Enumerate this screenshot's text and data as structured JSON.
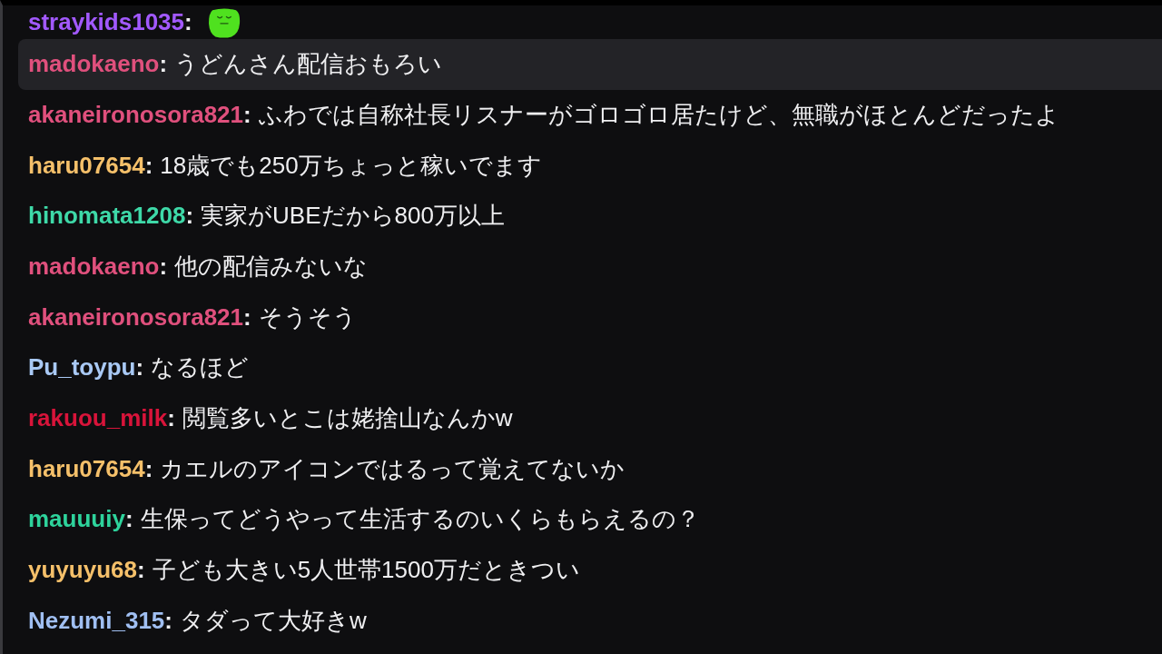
{
  "chat": {
    "messages": [
      {
        "kind": "emote",
        "username": "straykids1035",
        "color": "#a259ff",
        "separator": ":",
        "highlighted": false
      },
      {
        "kind": "text",
        "username": "madokaeno",
        "color": "#e0507d",
        "separator": ":",
        "text": "うどんさん配信おもろい",
        "highlighted": true
      },
      {
        "kind": "text",
        "username": "akaneironosora821",
        "color": "#e0507d",
        "separator": ":",
        "text": "ふわでは自称社長リスナーがゴロゴロ居たけど、無職がほとんどだったよ",
        "highlighted": false
      },
      {
        "kind": "text",
        "username": "haru07654",
        "color": "#f5c06a",
        "separator": ":",
        "text": "18歳でも250万ちょっと稼いでます",
        "highlighted": false
      },
      {
        "kind": "text",
        "username": "hinomata1208",
        "color": "#3ed9a8",
        "separator": ":",
        "text": "実家がUBEだから800万以上",
        "highlighted": false
      },
      {
        "kind": "text",
        "username": "madokaeno",
        "color": "#e0507d",
        "separator": ":",
        "text": "他の配信みないな",
        "highlighted": false
      },
      {
        "kind": "text",
        "username": "akaneironosora821",
        "color": "#e0507d",
        "separator": ":",
        "text": "そうそう",
        "highlighted": false
      },
      {
        "kind": "text",
        "username": "Pu_toypu",
        "color": "#a9c9f5",
        "separator": ":",
        "text": "なるほど",
        "highlighted": false
      },
      {
        "kind": "text",
        "username": "rakuou_milk",
        "color": "#d8143a",
        "separator": ":",
        "text": "閲覧多いとこは姥捨山なんかw",
        "highlighted": false
      },
      {
        "kind": "text",
        "username": "haru07654",
        "color": "#f5c06a",
        "separator": ":",
        "text": "カエルのアイコンではるって覚えてないか",
        "highlighted": false
      },
      {
        "kind": "text",
        "username": "mauuuiy",
        "color": "#2ed39c",
        "separator": ":",
        "text": "生保ってどうやって生活するのいくらもらえるの？",
        "highlighted": false
      },
      {
        "kind": "text",
        "username": "yuyuyu68",
        "color": "#f5c06a",
        "separator": ":",
        "text": "子ども大きい5人世帯1500万だときつい",
        "highlighted": false
      },
      {
        "kind": "text",
        "username": "Nezumi_315",
        "color": "#a0bff2",
        "separator": ":",
        "text": "タダって大好きw",
        "highlighted": false
      }
    ]
  }
}
